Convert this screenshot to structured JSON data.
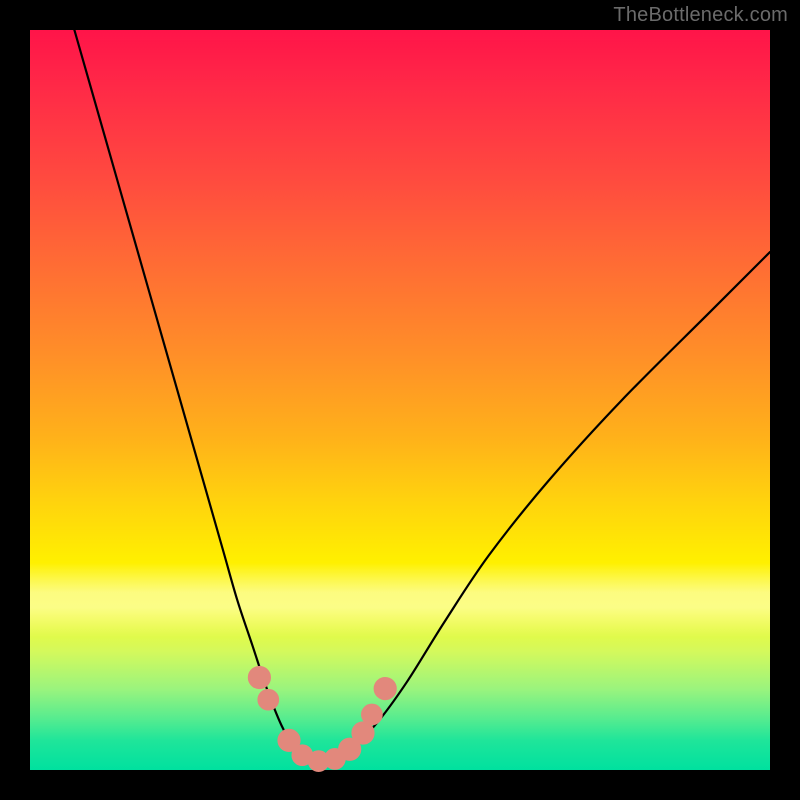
{
  "watermark": "TheBottleneck.com",
  "colors": {
    "page_bg": "#000000",
    "gradient_stops": [
      "#ff1449",
      "#ff2a47",
      "#ff4a3f",
      "#ff6d34",
      "#ff8f28",
      "#ffb11a",
      "#ffd40d",
      "#fff000",
      "#f7fb2a",
      "#d4f95c",
      "#9bf47d",
      "#57ec8f",
      "#1fe59a",
      "#00e19f"
    ],
    "curve": "#000000",
    "marker": "#e2887c"
  },
  "chart_data": {
    "type": "line",
    "title": "",
    "xlabel": "",
    "ylabel": "",
    "xlim": [
      0,
      1
    ],
    "ylim": [
      0,
      1
    ],
    "series": [
      {
        "name": "bottleneck-curve",
        "x": [
          0.06,
          0.1,
          0.14,
          0.18,
          0.22,
          0.26,
          0.28,
          0.3,
          0.32,
          0.34,
          0.355,
          0.37,
          0.385,
          0.4,
          0.42,
          0.44,
          0.47,
          0.51,
          0.56,
          0.62,
          0.7,
          0.8,
          0.92,
          1.0
        ],
        "y": [
          1.0,
          0.86,
          0.72,
          0.58,
          0.44,
          0.3,
          0.23,
          0.17,
          0.11,
          0.06,
          0.035,
          0.02,
          0.012,
          0.012,
          0.02,
          0.035,
          0.065,
          0.12,
          0.2,
          0.29,
          0.39,
          0.5,
          0.62,
          0.7
        ]
      }
    ],
    "markers": [
      {
        "x": 0.31,
        "y": 0.125,
        "r": 0.015
      },
      {
        "x": 0.322,
        "y": 0.095,
        "r": 0.014
      },
      {
        "x": 0.35,
        "y": 0.04,
        "r": 0.015
      },
      {
        "x": 0.368,
        "y": 0.02,
        "r": 0.014
      },
      {
        "x": 0.39,
        "y": 0.012,
        "r": 0.014
      },
      {
        "x": 0.412,
        "y": 0.015,
        "r": 0.014
      },
      {
        "x": 0.432,
        "y": 0.028,
        "r": 0.015
      },
      {
        "x": 0.45,
        "y": 0.05,
        "r": 0.015
      },
      {
        "x": 0.462,
        "y": 0.075,
        "r": 0.014
      },
      {
        "x": 0.48,
        "y": 0.11,
        "r": 0.015
      }
    ],
    "note": "Coordinates are normalized to [0,1] in plot-area space; y=0 is the bottom (green) edge. Values are visual estimates from the rendered chart (no axis ticks present)."
  }
}
